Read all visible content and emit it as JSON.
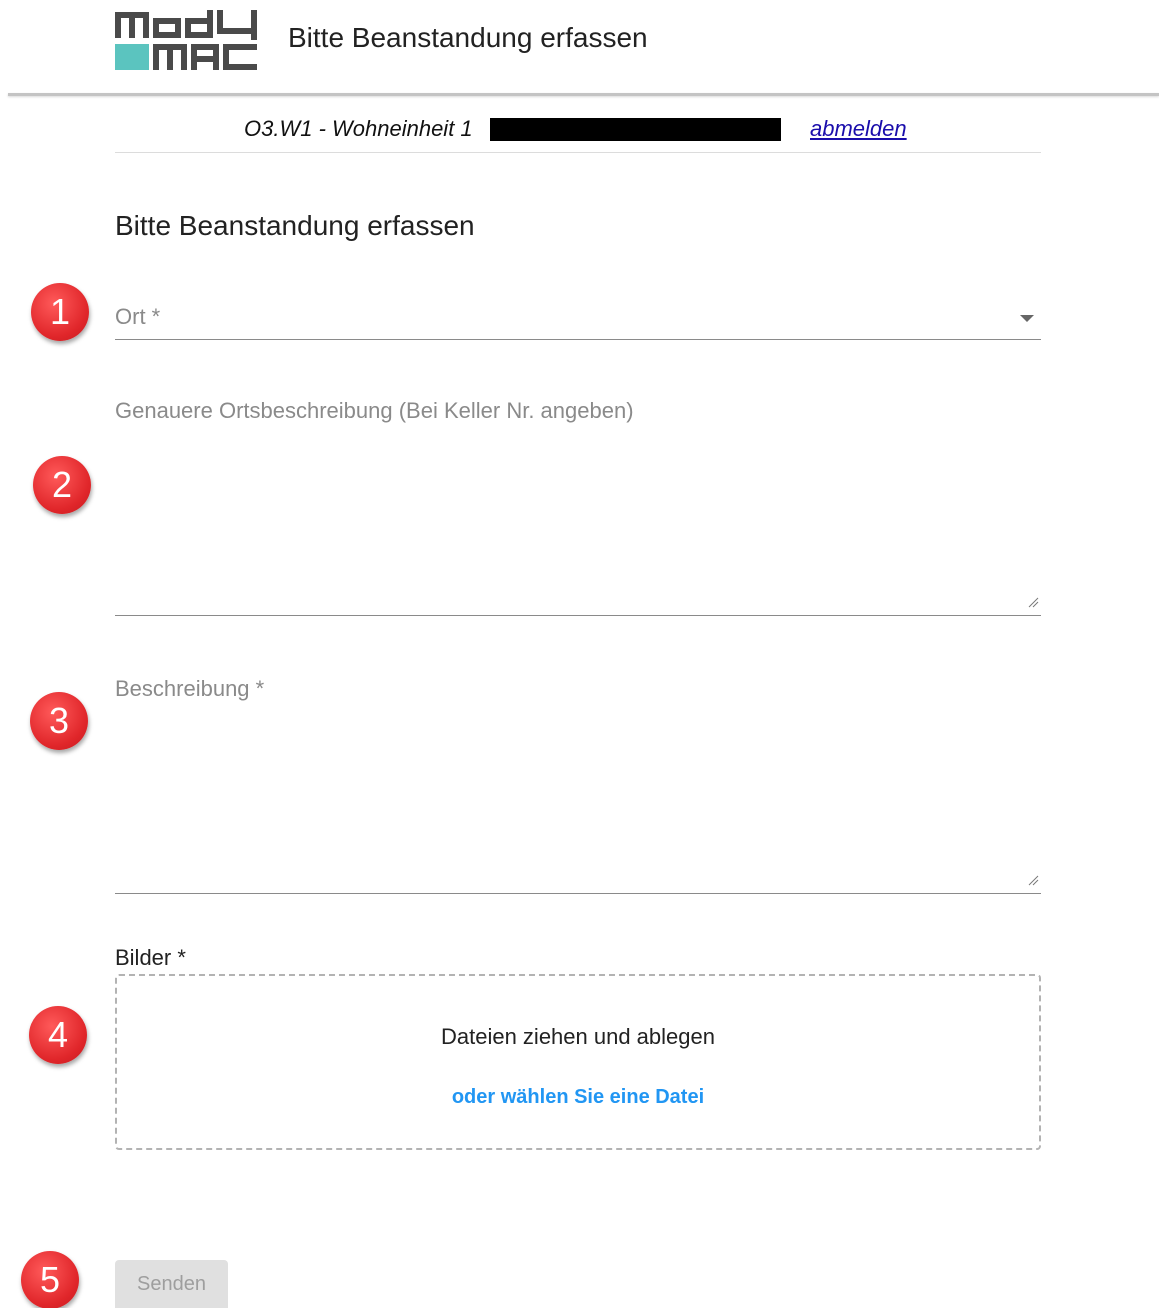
{
  "header": {
    "logo_text": "mody mac",
    "title": "Bitte Beanstandung erfassen"
  },
  "unit_bar": {
    "unit": "O3.W1 - Wohneinheit 1",
    "logout": "abmelden"
  },
  "form": {
    "title": "Bitte Beanstandung erfassen",
    "ort_label": "Ort *",
    "ort_description_label": "Genauere Ortsbeschreibung (Bei Keller Nr. angeben)",
    "description_label": "Beschreibung *",
    "images_label": "Bilder *",
    "drop_text": "Dateien ziehen und ablegen",
    "choose_file": "oder wählen Sie eine Datei",
    "submit": "Senden"
  },
  "steps": [
    "1",
    "2",
    "3",
    "4",
    "5"
  ],
  "colors": {
    "badge_red": "#e0262a",
    "link_blue": "#2196f3",
    "logo_teal": "#5bc4bf",
    "logo_gray": "#4a4a4a"
  }
}
